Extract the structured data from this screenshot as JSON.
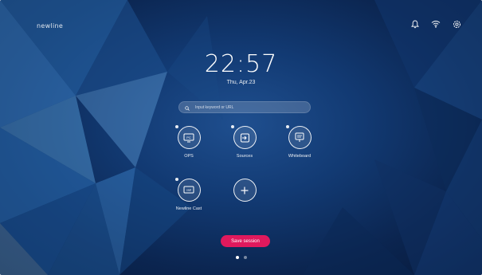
{
  "brand": "newline",
  "status_icons": [
    "bell-icon",
    "wifi-icon",
    "settings-icon"
  ],
  "clock": {
    "time": "22:57",
    "date": "Thu, Apr.23"
  },
  "search": {
    "placeholder": "Input keyword or URL",
    "icon": "search-icon"
  },
  "apps": [
    {
      "label": "OPS",
      "icon": "pc-icon",
      "glyph": "PC"
    },
    {
      "label": "Sources",
      "icon": "sources-icon"
    },
    {
      "label": "Whiteboard",
      "icon": "whiteboard-icon"
    },
    {
      "label": "Newline Cast",
      "icon": "cast-icon",
      "glyph": "cast"
    },
    {
      "label": "",
      "icon": "add-icon"
    }
  ],
  "save_button": "Save session",
  "pagination": {
    "pages": 2,
    "current": 1
  },
  "colors": {
    "accent": "#e0195d",
    "bg": "#123a73"
  }
}
